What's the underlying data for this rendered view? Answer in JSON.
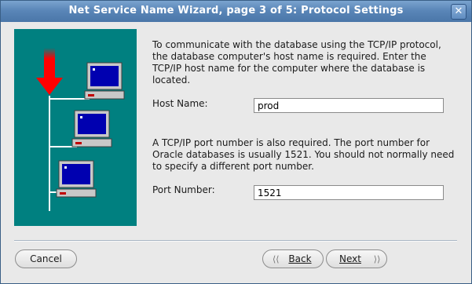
{
  "window": {
    "title": "Net Service Name Wizard, page 3 of 5: Protocol Settings",
    "close_glyph": "✕"
  },
  "intro_text": "To communicate with the database using the TCP/IP protocol, the database computer's host name is required.  Enter the TCP/IP host name for the computer where the database is located.",
  "host": {
    "label": "Host Name:",
    "value": "prod"
  },
  "port_text": "A TCP/IP port number is also required.  The port number for Oracle databases is usually 1521.  You should not normally need to specify a different port number.",
  "port": {
    "label": "Port Number:",
    "value": "1521"
  },
  "buttons": {
    "cancel": "Cancel",
    "back": "Back",
    "next": "Next"
  },
  "icons": {
    "back": "chevron-left-icon",
    "next": "chevron-right-icon",
    "close": "close-icon"
  },
  "colors": {
    "titlebar": "#5a86b8",
    "illustration_bg": "#008080",
    "arrow": "#e00000",
    "screen": "#0000b0"
  }
}
